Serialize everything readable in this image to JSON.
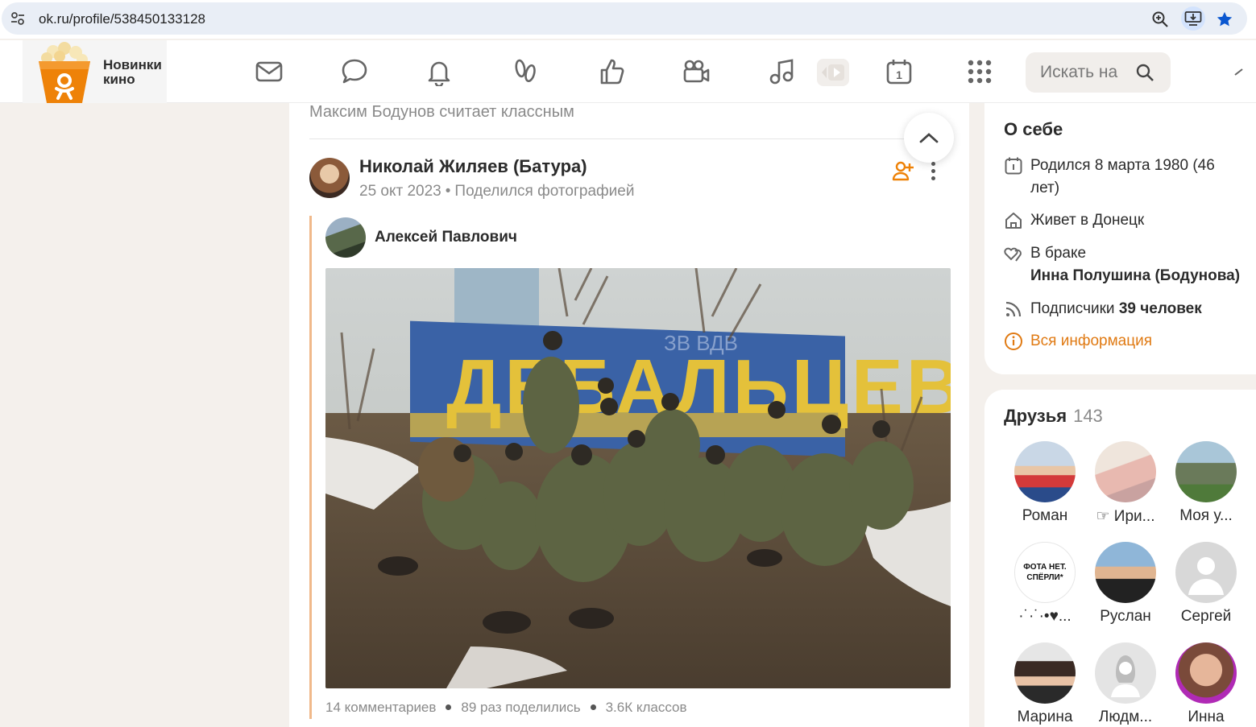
{
  "browser": {
    "url": "ok.ru/profile/538450133128",
    "icons": [
      "tune-icon",
      "zoom-icon",
      "install-app-icon",
      "bookmark-star-icon"
    ]
  },
  "header": {
    "promo_label": "Новинки кино",
    "search_placeholder": "Искать на",
    "nav_icons": [
      "mail-icon",
      "chat-icon",
      "bell-icon",
      "guests-icon",
      "like-icon",
      "camera-icon",
      "music-icon",
      "video-icon",
      "calendar-icon",
      "apps-icon"
    ],
    "calendar_day": "1",
    "brand_color": "#ee8208"
  },
  "feed": {
    "liked_by": "Максим Бодунов считает классным",
    "post": {
      "author": "Николай Жиляев (Батура)",
      "date": "25 окт 2023",
      "meta_dot": "•",
      "action": "Поделился фотографией",
      "repost": {
        "author": "Алексей Павлович",
        "photo_sign_text": "ДЕБАЛЬЦЕВО",
        "photo_graffiti": "ЗВ ВДВ"
      },
      "stats": {
        "comments": "14 комментариев",
        "shares": "89 раз поделились",
        "likes": "3.6К классов"
      }
    }
  },
  "about": {
    "title": "О себе",
    "birth": "Родился 8 марта 1980 (46 лет)",
    "lives": "Живет в Донецк",
    "married_prefix": "В браке",
    "spouse": "Инна Полушина (Бодунова)",
    "followers_prefix": "Подписчики",
    "followers_count": "39 человек",
    "all_info": "Вся информация"
  },
  "friends": {
    "title": "Друзья",
    "count": "143",
    "items": [
      {
        "name": "Роман"
      },
      {
        "name": "☞ Ири..."
      },
      {
        "name": "Моя у..."
      },
      {
        "name": "·˙·˙·•♥..."
      },
      {
        "name": "Руслан"
      },
      {
        "name": "Сергей"
      },
      {
        "name": "Марина"
      },
      {
        "name": "Людм..."
      },
      {
        "name": "Инна"
      }
    ],
    "avatar_caption": "ФОТА НЕТ. СПЁРЛИ*"
  }
}
